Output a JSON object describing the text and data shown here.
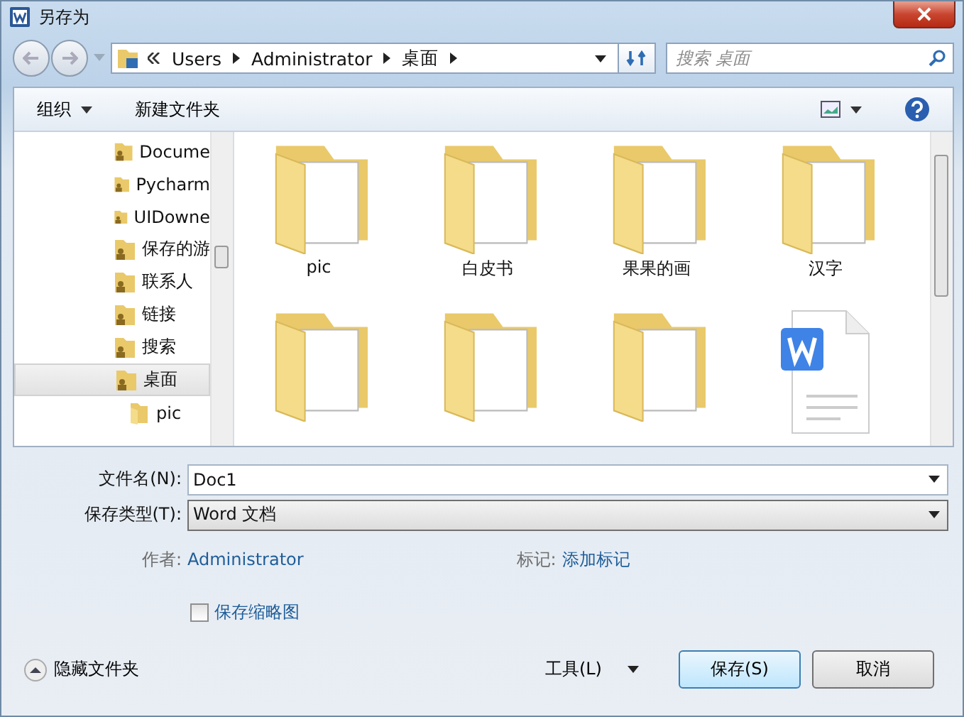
{
  "window": {
    "title": "另存为"
  },
  "navigation": {
    "address": [
      "Users",
      "Administrator",
      "桌面"
    ],
    "search": {
      "placeholder": "搜索 桌面"
    }
  },
  "toolbar": {
    "organize": "组织",
    "new_folder": "新建文件夹"
  },
  "sidebar": {
    "items": [
      {
        "label": "Docume",
        "selected": false
      },
      {
        "label": "Pycharm",
        "selected": false
      },
      {
        "label": "UIDowne",
        "selected": false
      },
      {
        "label": "保存的游",
        "selected": false
      },
      {
        "label": "联系人",
        "selected": false
      },
      {
        "label": "链接",
        "selected": false
      },
      {
        "label": "搜索",
        "selected": false
      },
      {
        "label": "桌面",
        "selected": true,
        "children": [
          {
            "label": "pic",
            "selected": false
          }
        ]
      }
    ]
  },
  "files": [
    {
      "kind": "folder",
      "label": "pic"
    },
    {
      "kind": "folder",
      "label": "白皮书"
    },
    {
      "kind": "folder",
      "label": "果果的画"
    },
    {
      "kind": "folder",
      "label": "汉字"
    },
    {
      "kind": "folder"
    },
    {
      "kind": "folder"
    },
    {
      "kind": "folder"
    },
    {
      "kind": "document"
    }
  ],
  "form": {
    "file_name": {
      "label": "文件名(N):",
      "value": "Doc1"
    },
    "file_type": {
      "label": "保存类型(T):",
      "value": "Word 文档"
    },
    "author": {
      "label": "作者:",
      "value": "Administrator"
    },
    "tags": {
      "label": "标记:",
      "value": "添加标记"
    },
    "thumbnail": {
      "label": "保存缩略图",
      "checked": false
    }
  },
  "footer": {
    "hide_folders": "隐藏文件夹",
    "tools": "工具(L)",
    "save": "保存(S)",
    "cancel": "取消"
  }
}
